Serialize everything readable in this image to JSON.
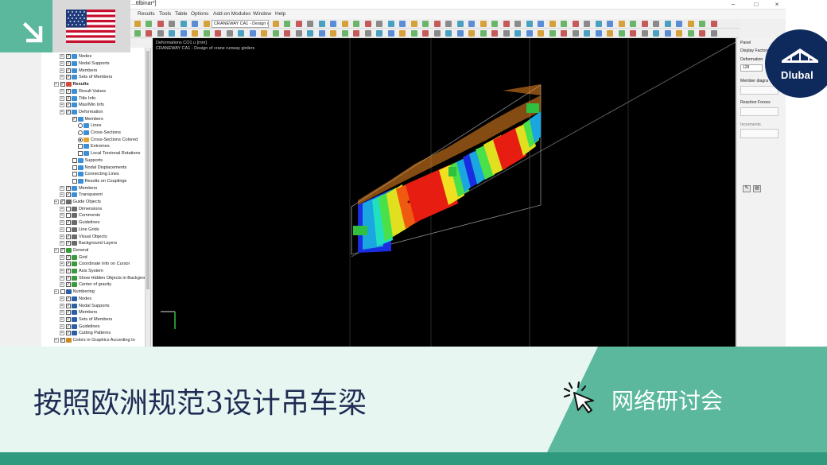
{
  "app": {
    "window_title": "...ttlbinar*]",
    "menus": [
      "Results",
      "Tools",
      "Table",
      "Options",
      "Add-on Modules",
      "Window",
      "Help"
    ],
    "design_case": "CRANEWAY CA1 - Design o",
    "viewport_lines": [
      "Deformations CO1 u [mm]",
      "CRANEWAY CA1 - Design of crane runway girders"
    ],
    "window_buttons": [
      "–",
      "□",
      "×"
    ]
  },
  "navigator": {
    "rows": [
      {
        "label": "Nodes",
        "indent": 2,
        "check": true,
        "icon": "nodes-icon",
        "color": "#3a8fd6"
      },
      {
        "label": "Nodal Supports",
        "indent": 2,
        "check": true,
        "icon": "support-icon",
        "color": "#3a8fd6"
      },
      {
        "label": "Members",
        "indent": 2,
        "check": true,
        "icon": "member-icon",
        "color": "#3a8fd6"
      },
      {
        "label": "Sets of Members",
        "indent": 2,
        "check": true,
        "icon": "member-set-icon",
        "color": "#3a8fd6"
      },
      {
        "label": "Results",
        "indent": 1,
        "check": true,
        "icon": "results-icon",
        "color": "#d24a3a",
        "bold": true
      },
      {
        "label": "Result Values",
        "indent": 2,
        "check": true,
        "icon": "result-values-icon",
        "color": "#3a8fd6"
      },
      {
        "label": "Title Info",
        "indent": 2,
        "check": true,
        "icon": "title-info-icon",
        "color": "#3a8fd6"
      },
      {
        "label": "Max/Min Info",
        "indent": 2,
        "check": true,
        "icon": "maxmin-info-icon",
        "color": "#3a8fd6"
      },
      {
        "label": "Deformation",
        "indent": 2,
        "check": true,
        "icon": "deformation-icon",
        "color": "#3a8fd6"
      },
      {
        "label": "Members",
        "indent": 3,
        "check": true,
        "icon": "member-icon",
        "color": "#3a8fd6"
      },
      {
        "label": "Lines",
        "indent": 4,
        "radio": false,
        "icon": "lines-icon",
        "color": "#3a8fd6"
      },
      {
        "label": "Cross-Sections",
        "indent": 4,
        "radio": false,
        "icon": "cross-section-icon",
        "color": "#3a8fd6"
      },
      {
        "label": "Cross-Sections Colored",
        "indent": 4,
        "radio": true,
        "icon": "cross-section-colored-icon",
        "color": "#e3a32f"
      },
      {
        "label": "Extremes",
        "indent": 4,
        "check": false,
        "icon": "extremes-icon",
        "color": "#3a8fd6"
      },
      {
        "label": "Local Torsional Rotations",
        "indent": 4,
        "check": false,
        "icon": "torsion-icon",
        "color": "#3a8fd6"
      },
      {
        "label": "Supports",
        "indent": 3,
        "check": false,
        "icon": "support-icon",
        "color": "#3a8fd6"
      },
      {
        "label": "Nodal Displacements",
        "indent": 3,
        "check": false,
        "icon": "displacement-icon",
        "color": "#3a8fd6"
      },
      {
        "label": "Connecting Lines",
        "indent": 3,
        "check": false,
        "icon": "connecting-lines-icon",
        "color": "#3a8fd6"
      },
      {
        "label": "Results on Couplings",
        "indent": 3,
        "check": false,
        "icon": "couplings-icon",
        "color": "#3a8fd6"
      },
      {
        "label": "Members",
        "indent": 2,
        "check": true,
        "icon": "member-icon",
        "color": "#3a8fd6"
      },
      {
        "label": "Transparent",
        "indent": 2,
        "check": true,
        "icon": "transparent-icon",
        "color": "#3a8fd6"
      },
      {
        "label": "Guide Objects",
        "indent": 1,
        "check": true,
        "icon": "guide-objects-icon",
        "color": "#6a6a6a"
      },
      {
        "label": "Dimensions",
        "indent": 2,
        "check": false,
        "icon": "dimensions-icon",
        "color": "#6a6a6a"
      },
      {
        "label": "Comments",
        "indent": 2,
        "check": false,
        "icon": "comments-icon",
        "color": "#6a6a6a"
      },
      {
        "label": "Guidelines",
        "indent": 2,
        "check": true,
        "icon": "guidelines-icon",
        "color": "#6a6a6a"
      },
      {
        "label": "Line Grids",
        "indent": 2,
        "check": false,
        "icon": "line-grids-icon",
        "color": "#6a6a6a"
      },
      {
        "label": "Visual Objects",
        "indent": 2,
        "check": true,
        "icon": "visual-objects-icon",
        "color": "#6a6a6a"
      },
      {
        "label": "Background Layers",
        "indent": 2,
        "check": true,
        "icon": "background-layers-icon",
        "color": "#6a6a6a"
      },
      {
        "label": "General",
        "indent": 1,
        "check": true,
        "icon": "general-icon",
        "color": "#3a9a3a"
      },
      {
        "label": "Grid",
        "indent": 2,
        "check": true,
        "icon": "grid-icon",
        "color": "#3a9a3a"
      },
      {
        "label": "Coordinate Info on Cursor",
        "indent": 2,
        "check": true,
        "icon": "coordinate-info-icon",
        "color": "#3a9a3a"
      },
      {
        "label": "Axis System",
        "indent": 2,
        "check": true,
        "icon": "axis-system-icon",
        "color": "#3a9a3a"
      },
      {
        "label": "Show Hidden Objects in Backgrou",
        "indent": 2,
        "check": true,
        "icon": "hidden-objects-icon",
        "color": "#3a9a3a"
      },
      {
        "label": "Center of gravity",
        "indent": 2,
        "check": true,
        "icon": "center-gravity-icon",
        "color": "#3a9a3a"
      },
      {
        "label": "Numbering",
        "indent": 1,
        "check": false,
        "icon": "numbering-icon",
        "color": "#2a5fa8"
      },
      {
        "label": "Nodes",
        "indent": 2,
        "check": true,
        "icon": "numbering-nodes-icon",
        "color": "#2a5fa8"
      },
      {
        "label": "Nodal Supports",
        "indent": 2,
        "check": true,
        "icon": "numbering-supports-icon",
        "color": "#2a5fa8"
      },
      {
        "label": "Members",
        "indent": 2,
        "check": true,
        "icon": "numbering-members-icon",
        "color": "#2a5fa8"
      },
      {
        "label": "Sets of Members",
        "indent": 2,
        "check": true,
        "icon": "numbering-sets-icon",
        "color": "#2a5fa8"
      },
      {
        "label": "Guidelines",
        "indent": 2,
        "check": true,
        "icon": "numbering-guidelines-icon",
        "color": "#2a5fa8"
      },
      {
        "label": "Cutting Patterns",
        "indent": 2,
        "check": true,
        "icon": "numbering-cutting-icon",
        "color": "#2a5fa8"
      },
      {
        "label": "Colors in Graphics According to",
        "indent": 1,
        "check": true,
        "icon": "colors-icon",
        "color": "#c98a1a"
      }
    ]
  },
  "panel": {
    "title": "Panel",
    "display_factors": "Display Factors",
    "deformation_label": "Deformation",
    "deformation_value": "128",
    "member_diagrams": "Member diagra",
    "reaction_forces": "Reaction Forces",
    "increments": "Increments"
  },
  "overlay": {
    "flag": "us-flag-icon",
    "logo_text": "Dlubal"
  },
  "banner": {
    "title": "按照欧洲规范3设计吊车梁",
    "webinar": "网络研讨会"
  },
  "colors": {
    "accent_green": "#5bb89d",
    "dark_green": "#2f9a7d",
    "banner_light": "#e8f6f2",
    "navy": "#1e2c54",
    "logo_navy": "#0e2a5c"
  }
}
